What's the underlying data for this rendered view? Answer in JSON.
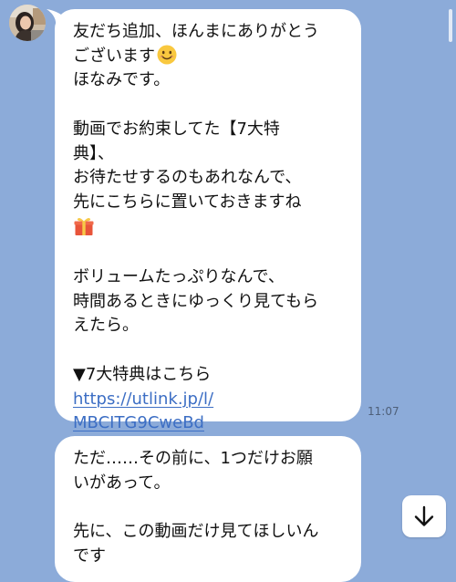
{
  "messages": [
    {
      "lines": [
        "友だち追加、ほんまにありがとう",
        "ございます",
        "ほなみです。",
        "",
        "動画でお約束してた【7大特",
        "典】、",
        "お待たせするのもあれなんで、",
        "先にこちらに置いておきますね",
        "",
        "",
        "ボリュームたっぷりなんで、",
        "時間あるときにゆっくり見てもら",
        "えたら。",
        "",
        "▼7大特典はこちら"
      ],
      "emoji_smile": "smiling-face-emoji",
      "emoji_gift": "wrapped-gift-emoji",
      "link": [
        "https://utlink.jp/l/",
        "MBCITG9CweBd"
      ],
      "time": "11:07"
    },
    {
      "lines": [
        "ただ……その前に、1つだけお願",
        "いがあって。",
        "",
        "先に、この動画だけ見てほしいん",
        "です"
      ]
    }
  ],
  "colors": {
    "background": "#8cabd9",
    "bubble": "#ffffff",
    "link": "#3c6ec4",
    "timestamp": "#4e5f78"
  },
  "icons": {
    "scroll_down": "arrow-down-icon",
    "avatar": "avatar-photo"
  }
}
